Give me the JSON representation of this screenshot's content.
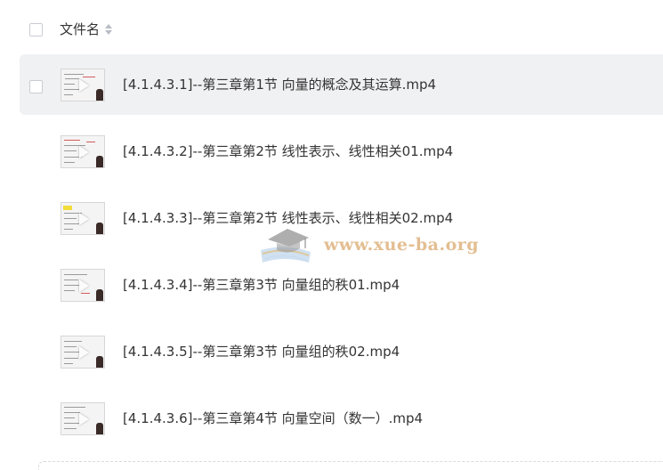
{
  "header": {
    "column_label": "文件名",
    "sort_icon": "sort-caret-icon"
  },
  "files": [
    {
      "name": "[4.1.4.3.1]--第三章第1节 向量的概念及其运算.mp4",
      "hovered": true
    },
    {
      "name": "[4.1.4.3.2]--第三章第2节 线性表示、线性相关01.mp4",
      "hovered": false
    },
    {
      "name": "[4.1.4.3.3]--第三章第2节 线性表示、线性相关02.mp4",
      "hovered": false
    },
    {
      "name": "[4.1.4.3.4]--第三章第3节 向量组的秩01.mp4",
      "hovered": false
    },
    {
      "name": "[4.1.4.3.5]--第三章第3节 向量组的秩02.mp4",
      "hovered": false
    },
    {
      "name": "[4.1.4.3.6]--第三章第4节 向量空间（数一）.mp4",
      "hovered": false
    }
  ],
  "watermark": {
    "text": "www.xue-ba.org",
    "icon": "graduation-cap-book-icon"
  },
  "colors": {
    "row_hover_bg": "#f0f1f3",
    "text": "#333333",
    "watermark": "#daa86e"
  }
}
